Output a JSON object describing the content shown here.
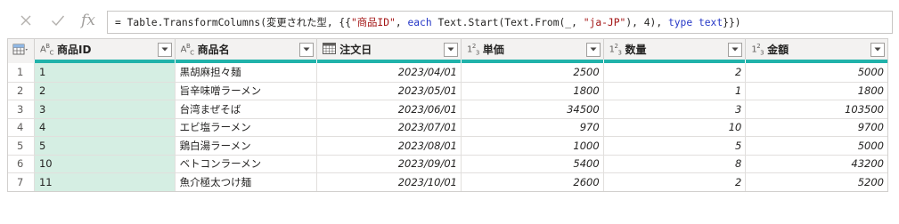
{
  "formula_bar": {
    "cancel_icon": "close-icon",
    "commit_icon": "check-icon",
    "fx_label": "fx",
    "formula_segments": [
      {
        "text": "= Table.TransformColumns(変更された型, {{",
        "kind": "plain"
      },
      {
        "text": "\"商品ID\"",
        "kind": "str"
      },
      {
        "text": ", ",
        "kind": "plain"
      },
      {
        "text": "each",
        "kind": "kw"
      },
      {
        "text": " Text.Start(Text.From(_, ",
        "kind": "plain"
      },
      {
        "text": "\"ja-JP\"",
        "kind": "str"
      },
      {
        "text": "), 4), ",
        "kind": "plain"
      },
      {
        "text": "type text",
        "kind": "kw"
      },
      {
        "text": "}})",
        "kind": "plain"
      }
    ]
  },
  "colors": {
    "quality": "#20b2aa",
    "selected_column": "#d5eee3",
    "keyword": "#2436c6",
    "string": "#a31515"
  },
  "table": {
    "corner_icon": "table-menu-icon",
    "columns": [
      {
        "label": "商品ID",
        "type": "text",
        "type_sym": "ABC"
      },
      {
        "label": "商品名",
        "type": "text",
        "type_sym": "ABC"
      },
      {
        "label": "注文日",
        "type": "date",
        "type_sym": "calendar"
      },
      {
        "label": "単価",
        "type": "number",
        "type_sym": "123"
      },
      {
        "label": "数量",
        "type": "number",
        "type_sym": "123"
      },
      {
        "label": "金額",
        "type": "number",
        "type_sym": "123"
      }
    ],
    "rows": [
      {
        "index": "1",
        "cells": [
          "1",
          "黒胡麻担々麺",
          "2023/04/01",
          "2500",
          "2",
          "5000"
        ]
      },
      {
        "index": "2",
        "cells": [
          "2",
          "旨辛味噌ラーメン",
          "2023/05/01",
          "1800",
          "1",
          "1800"
        ]
      },
      {
        "index": "3",
        "cells": [
          "3",
          "台湾まぜそば",
          "2023/06/01",
          "34500",
          "3",
          "103500"
        ]
      },
      {
        "index": "4",
        "cells": [
          "4",
          "エビ塩ラーメン",
          "2023/07/01",
          "970",
          "10",
          "9700"
        ]
      },
      {
        "index": "5",
        "cells": [
          "5",
          "鶏白湯ラーメン",
          "2023/08/01",
          "1000",
          "5",
          "5000"
        ]
      },
      {
        "index": "6",
        "cells": [
          "10",
          "ベトコンラーメン",
          "2023/09/01",
          "5400",
          "8",
          "43200"
        ]
      },
      {
        "index": "7",
        "cells": [
          "11",
          "魚介極太つけ麺",
          "2023/10/01",
          "2600",
          "2",
          "5200"
        ]
      }
    ]
  }
}
